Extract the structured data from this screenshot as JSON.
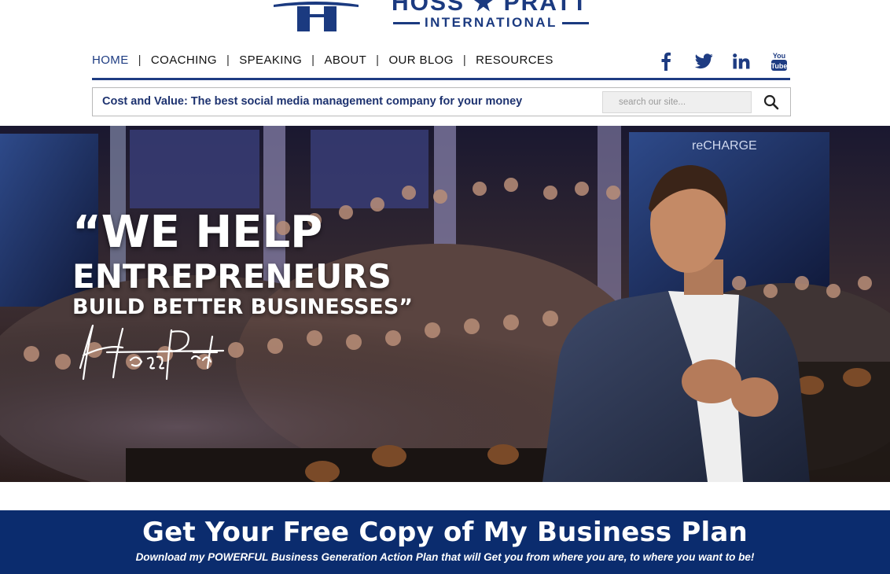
{
  "logo": {
    "name": "HOSS ★ PRATT",
    "tagline": "INTERNATIONAL"
  },
  "nav": {
    "items": [
      {
        "label": "HOME",
        "active": true
      },
      {
        "label": "COACHING"
      },
      {
        "label": "SPEAKING"
      },
      {
        "label": "ABOUT"
      },
      {
        "label": "OUR BLOG"
      },
      {
        "label": "RESOURCES"
      }
    ],
    "separator": "|"
  },
  "social": [
    "facebook-icon",
    "twitter-icon",
    "linkedin-icon",
    "youtube-icon"
  ],
  "search": {
    "page_title": "Cost and Value: The best social media management company for your money",
    "placeholder": "search our site..."
  },
  "hero": {
    "line1": "“WE HELP",
    "line2": "ENTREPRENEURS",
    "line3": "BUILD BETTER BUSINESSES”",
    "signature": "Hoss Pratt",
    "screen_brand": "reCHARGE"
  },
  "banner": {
    "title": "Get Your Free Copy of My Business Plan",
    "subtitle": "Download my POWERFUL Business Generation Action Plan that will Get you from where you are, to where you want to be!"
  },
  "colors": {
    "brand_navy": "#1e3c82",
    "banner_bg": "#0b2c6e"
  }
}
